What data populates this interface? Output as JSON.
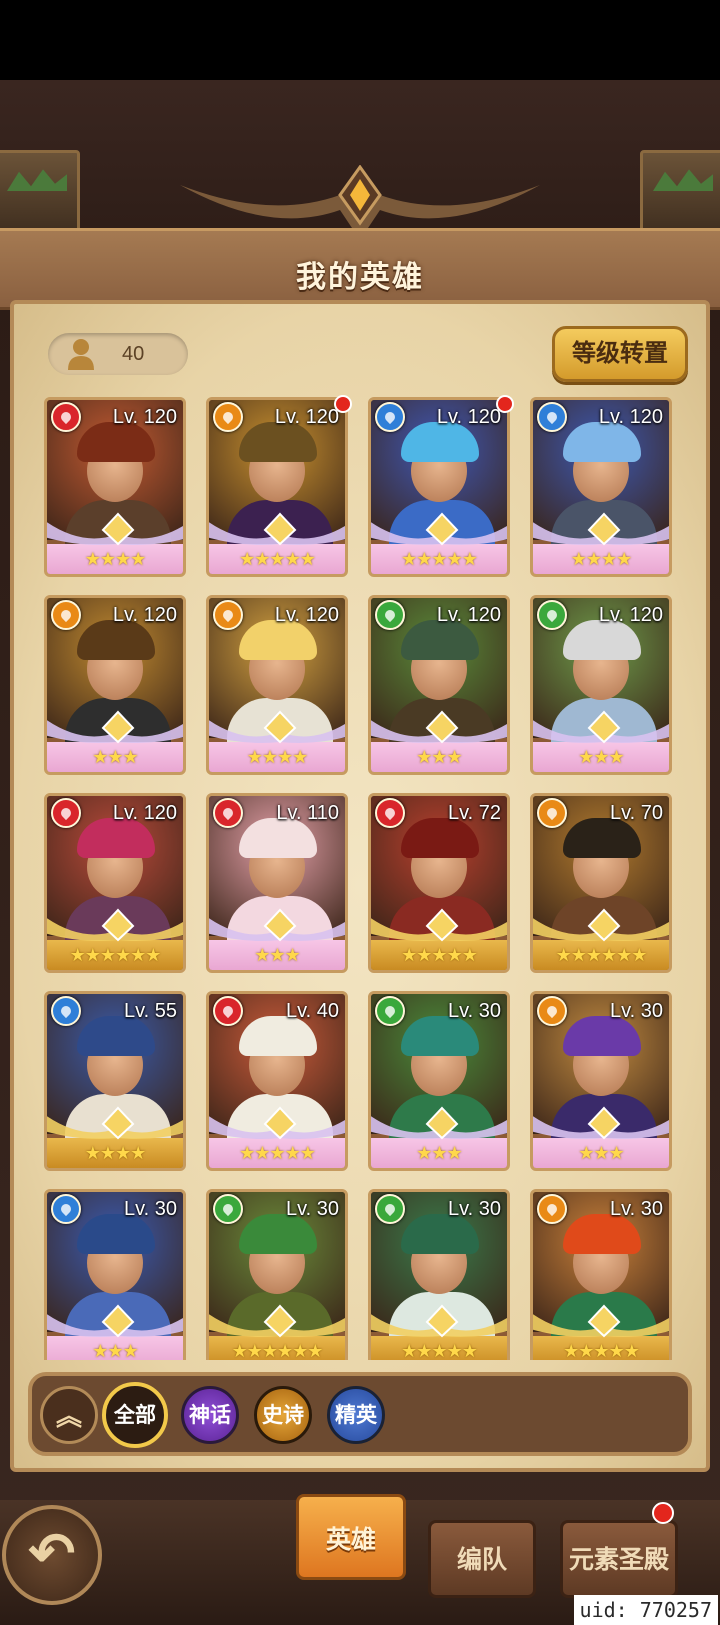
{
  "header": {
    "title": "我的英雄"
  },
  "hero_count": "40",
  "level_transfer_label": "等级转置",
  "elements": {
    "fire": "#d9262b",
    "earth": "#e98a16",
    "water": "#2f7fd8",
    "wind": "#3aa83c"
  },
  "heroes": [
    {
      "level": "Lv. 120",
      "element": "fire",
      "stars": "★★★★",
      "dot": false,
      "rarity": "myth",
      "hair": "#7b2c16",
      "bg": "#c25a32",
      "body": "#5b3f2b"
    },
    {
      "level": "Lv. 120",
      "element": "earth",
      "stars": "★★★★★",
      "dot": true,
      "rarity": "myth",
      "hair": "#6b5020",
      "bg": "#c7902f",
      "body": "#3c2150"
    },
    {
      "level": "Lv. 120",
      "element": "water",
      "stars": "★★★★★",
      "dot": true,
      "rarity": "myth",
      "hair": "#4fb6e6",
      "bg": "#3f57b3",
      "body": "#3b6bc6"
    },
    {
      "level": "Lv. 120",
      "element": "water",
      "stars": "★★★★",
      "dot": false,
      "rarity": "myth",
      "hair": "#7fb6e8",
      "bg": "#3d58b0",
      "body": "#4a5468"
    },
    {
      "level": "Lv. 120",
      "element": "earth",
      "stars": "★★★",
      "dot": false,
      "rarity": "myth",
      "hair": "#5a3a18",
      "bg": "#c08a30",
      "body": "#2e2e2e"
    },
    {
      "level": "Lv. 120",
      "element": "earth",
      "stars": "★★★★",
      "dot": false,
      "rarity": "myth",
      "hair": "#f2d16a",
      "bg": "#d1a040",
      "body": "#e7e2d4"
    },
    {
      "level": "Lv. 120",
      "element": "wind",
      "stars": "★★★",
      "dot": false,
      "rarity": "myth",
      "hair": "#3c5a40",
      "bg": "#5a8a3a",
      "body": "#4a3a24"
    },
    {
      "level": "Lv. 120",
      "element": "wind",
      "stars": "★★★",
      "dot": false,
      "rarity": "myth",
      "hair": "#d8d8d8",
      "bg": "#6e9a4a",
      "body": "#9fb8d2"
    },
    {
      "level": "Lv. 120",
      "element": "fire",
      "stars": "★★★★★★",
      "dot": false,
      "rarity": "epic",
      "hair": "#c22d5d",
      "bg": "#b84a3a",
      "body": "#6a3a5a"
    },
    {
      "level": "Lv. 110",
      "element": "fire",
      "stars": "★★★",
      "dot": false,
      "rarity": "myth",
      "hair": "#f3e0e0",
      "bg": "#e3a0a8",
      "body": "#f3d8e0"
    },
    {
      "level": "Lv. 72",
      "element": "fire",
      "stars": "★★★★★",
      "dot": false,
      "rarity": "epic",
      "hair": "#7a1a14",
      "bg": "#b8402e",
      "body": "#8a2a22"
    },
    {
      "level": "Lv. 70",
      "element": "earth",
      "stars": "★★★★★★",
      "dot": false,
      "rarity": "epic",
      "hair": "#2a2218",
      "bg": "#b07a2e",
      "body": "#6e4428"
    },
    {
      "level": "Lv. 55",
      "element": "water",
      "stars": "★★★★",
      "dot": false,
      "rarity": "epic",
      "hair": "#2e4a8a",
      "bg": "#3a5aa8",
      "body": "#e8e0d0"
    },
    {
      "level": "Lv. 40",
      "element": "fire",
      "stars": "★★★★★",
      "dot": false,
      "rarity": "myth",
      "hair": "#f0ece0",
      "bg": "#c85a3a",
      "body": "#f0ece0"
    },
    {
      "level": "Lv. 30",
      "element": "wind",
      "stars": "★★★",
      "dot": false,
      "rarity": "myth",
      "hair": "#2a8a7a",
      "bg": "#4a8a3a",
      "body": "#2e7a4a"
    },
    {
      "level": "Lv. 30",
      "element": "earth",
      "stars": "★★★",
      "dot": false,
      "rarity": "myth",
      "hair": "#6a3aa8",
      "bg": "#c08a40",
      "body": "#3a2a6a"
    },
    {
      "level": "Lv. 30",
      "element": "water",
      "stars": "★★★",
      "dot": false,
      "rarity": "myth",
      "hair": "#2a4a8a",
      "bg": "#3a5ab0",
      "body": "#4a6ab8"
    },
    {
      "level": "Lv. 30",
      "element": "wind",
      "stars": "★★★★★★",
      "dot": false,
      "rarity": "epic",
      "hair": "#3a8a3a",
      "bg": "#6a8a3a",
      "body": "#5a6a2a"
    },
    {
      "level": "Lv. 30",
      "element": "wind",
      "stars": "★★★★★",
      "dot": false,
      "rarity": "epic",
      "hair": "#2a6a4a",
      "bg": "#3a7a4a",
      "body": "#dde8e0"
    },
    {
      "level": "Lv. 30",
      "element": "earth",
      "stars": "★★★★★",
      "dot": false,
      "rarity": "epic",
      "hair": "#e04a1a",
      "bg": "#c8803a",
      "body": "#2a7a4a"
    }
  ],
  "filters": {
    "all": "全部",
    "myth": "神话",
    "epic": "史诗",
    "elite": "精英"
  },
  "tabs": {
    "hero": "英雄",
    "team": "编队",
    "temple": "元素圣殿"
  },
  "uid": "uid: 770257"
}
